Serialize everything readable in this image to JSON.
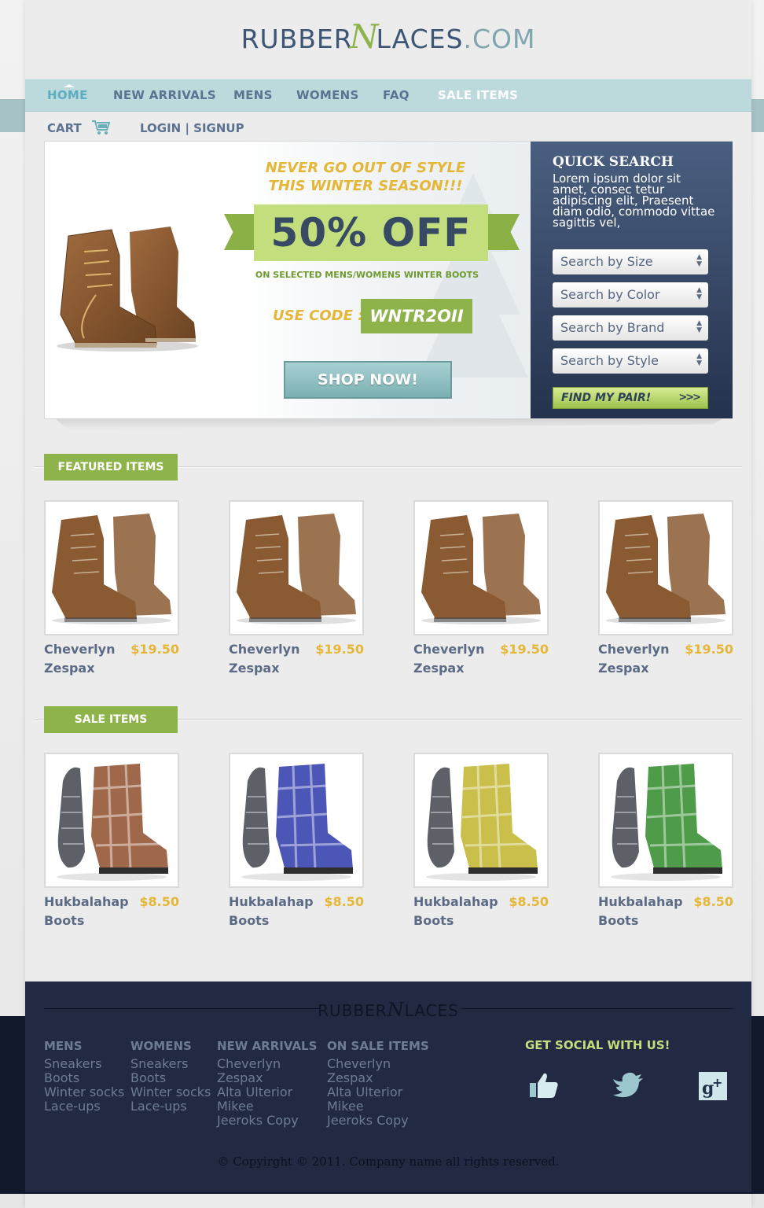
{
  "brand": {
    "name_left": "RUBBER",
    "script": "N",
    "name_right": "LACES",
    "domain": ".COM"
  },
  "nav": {
    "items": [
      {
        "label": "HOME"
      },
      {
        "label": "NEW ARRIVALS"
      },
      {
        "label": "MENS"
      },
      {
        "label": "WOMENS"
      },
      {
        "label": "FAQ"
      },
      {
        "label": "SALE ITEMS"
      }
    ],
    "active": "HOME"
  },
  "subbar": {
    "cart": "CART",
    "login": "LOGIN | SIGNUP"
  },
  "promo": {
    "tagline_1": "NEVER GO OUT OF STYLE",
    "tagline_2": "THIS WINTER SEASON!!!",
    "discount": "50% OFF",
    "subtext": "ON SELECTED MENS/WOMENS WINTER BOOTS",
    "code_label": "USE CODE :",
    "code": "WNTR2OII",
    "shop_button": "SHOP NOW!"
  },
  "quick_search": {
    "title": "QUICK SEARCH",
    "text": "Lorem ipsum dolor sit amet, consec tetur adipiscing elit, Praesent diam odio, commodo vittae sagittis vel,",
    "selects": [
      "Search by Size",
      "Search by Color",
      "Search by Brand",
      "Search by Style"
    ],
    "button": "FIND MY PAIR!",
    "button_icon": ">>>"
  },
  "featured": {
    "label": "FEATURED ITEMS",
    "items": [
      {
        "name_1": "Cheverlyn",
        "name_2": "Zespax",
        "price": "$19.50"
      },
      {
        "name_1": "Cheverlyn",
        "name_2": "Zespax",
        "price": "$19.50"
      },
      {
        "name_1": "Cheverlyn",
        "name_2": "Zespax",
        "price": "$19.50"
      },
      {
        "name_1": "Cheverlyn",
        "name_2": "Zespax",
        "price": "$19.50"
      }
    ]
  },
  "sale": {
    "label": "SALE ITEMS",
    "items": [
      {
        "name_1": "Hukbalahap",
        "name_2": "Boots",
        "price": "$8.50",
        "color": "#a0684a"
      },
      {
        "name_1": "Hukbalahap",
        "name_2": "Boots",
        "price": "$8.50",
        "color": "#4b56b6"
      },
      {
        "name_1": "Hukbalahap",
        "name_2": "Boots",
        "price": "$8.50",
        "color": "#c9bf4a"
      },
      {
        "name_1": "Hukbalahap",
        "name_2": "Boots",
        "price": "$8.50",
        "color": "#4e9c4a"
      }
    ]
  },
  "footer": {
    "logo_left": "RUBBER",
    "logo_script": "N",
    "logo_right": "LACES",
    "columns": [
      {
        "head": "MENS",
        "items": [
          "Sneakers",
          "Boots",
          "Winter socks",
          "Lace-ups"
        ]
      },
      {
        "head": "WOMENS",
        "items": [
          "Sneakers",
          "Boots",
          "Winter socks",
          "Lace-ups"
        ]
      },
      {
        "head": "NEW ARRIVALS",
        "items": [
          "Cheverlyn",
          "Zespax",
          "Alta Ulterior",
          "Mikee",
          "Jeeroks Copy"
        ]
      },
      {
        "head": "ON SALE ITEMS",
        "items": [
          "Cheverlyn",
          "Zespax",
          "Alta Ulterior",
          "Mikee",
          "Jeeroks Copy"
        ]
      }
    ],
    "social_title": "GET SOCIAL WITH US!",
    "social_icons": [
      "thumbs-up-icon",
      "twitter-bird-icon",
      "google-plus-icon"
    ],
    "copyright": "© Copyirght © 2011. Company name all rights reserved."
  },
  "colors": {
    "accent_green": "#8eb34a",
    "navy": "#212a42",
    "nav_bg": "#bcd9dc",
    "price_gold": "#e5b739"
  }
}
